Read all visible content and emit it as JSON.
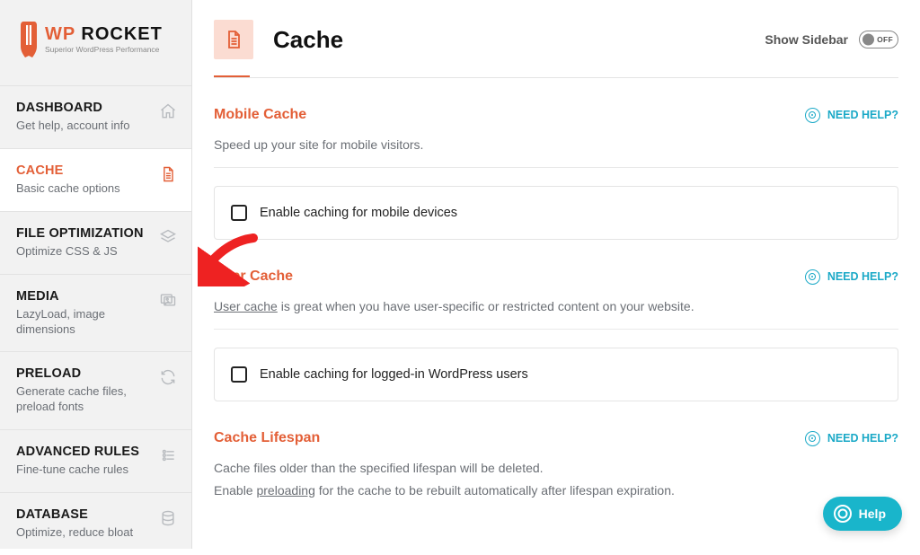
{
  "brand": {
    "name": "WP ROCKET",
    "tagline": "Superior WordPress Performance"
  },
  "sidebar": {
    "items": [
      {
        "title": "DASHBOARD",
        "sub": "Get help, account info"
      },
      {
        "title": "CACHE",
        "sub": "Basic cache options"
      },
      {
        "title": "FILE OPTIMIZATION",
        "sub": "Optimize CSS & JS"
      },
      {
        "title": "MEDIA",
        "sub": "LazyLoad, image dimensions"
      },
      {
        "title": "PRELOAD",
        "sub": "Generate cache files, preload fonts"
      },
      {
        "title": "ADVANCED RULES",
        "sub": "Fine-tune cache rules"
      },
      {
        "title": "DATABASE",
        "sub": "Optimize, reduce bloat"
      }
    ]
  },
  "header": {
    "title": "Cache",
    "show_sidebar_label": "Show Sidebar",
    "toggle_label": "OFF"
  },
  "sections": {
    "mobile": {
      "title": "Mobile Cache",
      "desc": "Speed up your site for mobile visitors.",
      "option": "Enable caching for mobile devices",
      "help": "NEED HELP?"
    },
    "user": {
      "title": "User Cache",
      "link": "User cache",
      "desc_rest": " is great when you have user-specific or restricted content on your website.",
      "option": "Enable caching for logged-in WordPress users",
      "help": "NEED HELP?"
    },
    "lifespan": {
      "title": "Cache Lifespan",
      "line1": "Cache files older than the specified lifespan will be deleted.",
      "line2a": "Enable ",
      "line2_link": "preloading",
      "line2b": " for the cache to be rebuilt automatically after lifespan expiration.",
      "help": "NEED HELP?"
    }
  },
  "help_fab": "Help"
}
